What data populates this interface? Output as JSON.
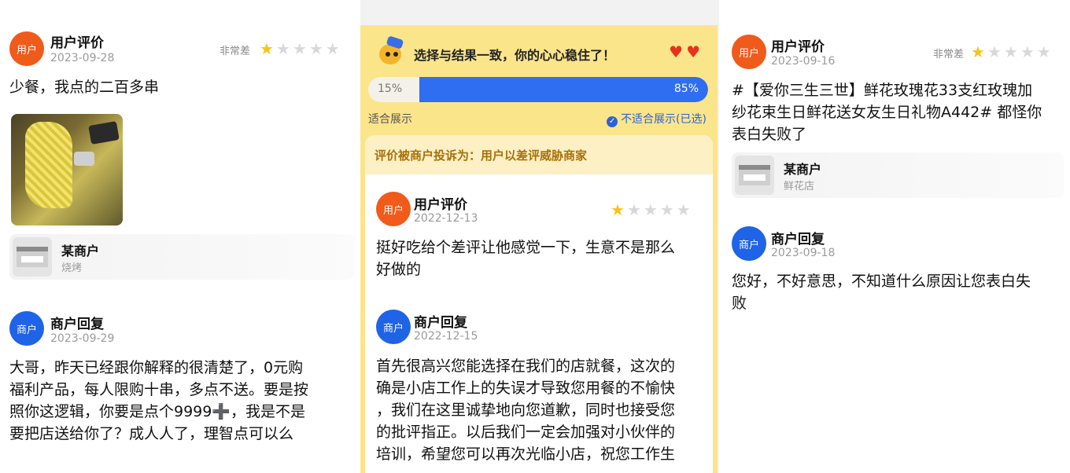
{
  "left": {
    "review": {
      "avatar": "用户",
      "name": "用户评价",
      "date": "2023-09-28",
      "rating_label": "非常差",
      "stars": 1,
      "text": "少餐，我点的二百多串"
    },
    "shop": {
      "name": "某商户",
      "category": "烧烤"
    },
    "reply": {
      "avatar": "商户",
      "name": "商户回复",
      "date": "2023-09-29",
      "lines": [
        "大哥，昨天已经跟你解释的很清楚了，0元购",
        "福利产品，每人限购十串，多点不送。要是按",
        "照你这逻辑，你要是点个9999➕，我是不是",
        "要把店送给你了？成人人了，理智点可以么"
      ]
    }
  },
  "middle": {
    "verdict": "选择与结果一致，你的心心稳住了！",
    "bar": {
      "left_label": "15%",
      "right_label": "85%",
      "right_fraction": 0.85
    },
    "option_left": "适合展示",
    "option_right": "不适合展示(已选)",
    "complaint": "评价被商户投诉为：用户以差评威胁商家",
    "review": {
      "avatar": "用户",
      "name": "用户评价",
      "date": "2022-12-13",
      "stars": 1,
      "lines": [
        "挺好吃给个差评让他感觉一下，生意不是那么",
        "好做的"
      ]
    },
    "reply": {
      "avatar": "商户",
      "name": "商户回复",
      "date": "2022-12-15",
      "lines": [
        "首先很高兴您能选择在我们的店就餐，这次的",
        "确是小店工作上的失误才导致您用餐的不愉快",
        "，我们在这里诚挚地向您道歉，同时也接受您",
        "的批评指正。以后我们一定会加强对小伙伴的",
        "培训，希望您可以再次光临小店，祝您工作生"
      ]
    }
  },
  "right": {
    "review": {
      "avatar": "用户",
      "name": "用户评价",
      "date": "2023-09-16",
      "rating_label": "非常差",
      "stars": 1,
      "lines": [
        "#【爱你三生三世】鲜花玫瑰花33支红玫瑰加",
        "纱花束生日鲜花送女友生日礼物A442# 都怪你",
        "表白失败了"
      ]
    },
    "shop": {
      "name": "某商户",
      "category": "鲜花店"
    },
    "reply": {
      "avatar": "商户",
      "name": "商户回复",
      "date": "2023-09-18",
      "lines": [
        "您好，不好意思，不知道什么原因让您表白失",
        "败"
      ]
    }
  },
  "colors": {
    "user_avatar": "#f05a1a",
    "merchant_avatar": "#1f63e6",
    "star_on": "#f7c31a",
    "accent_blue": "#2f6ef0",
    "panel_yellow": "#fbe58a"
  }
}
